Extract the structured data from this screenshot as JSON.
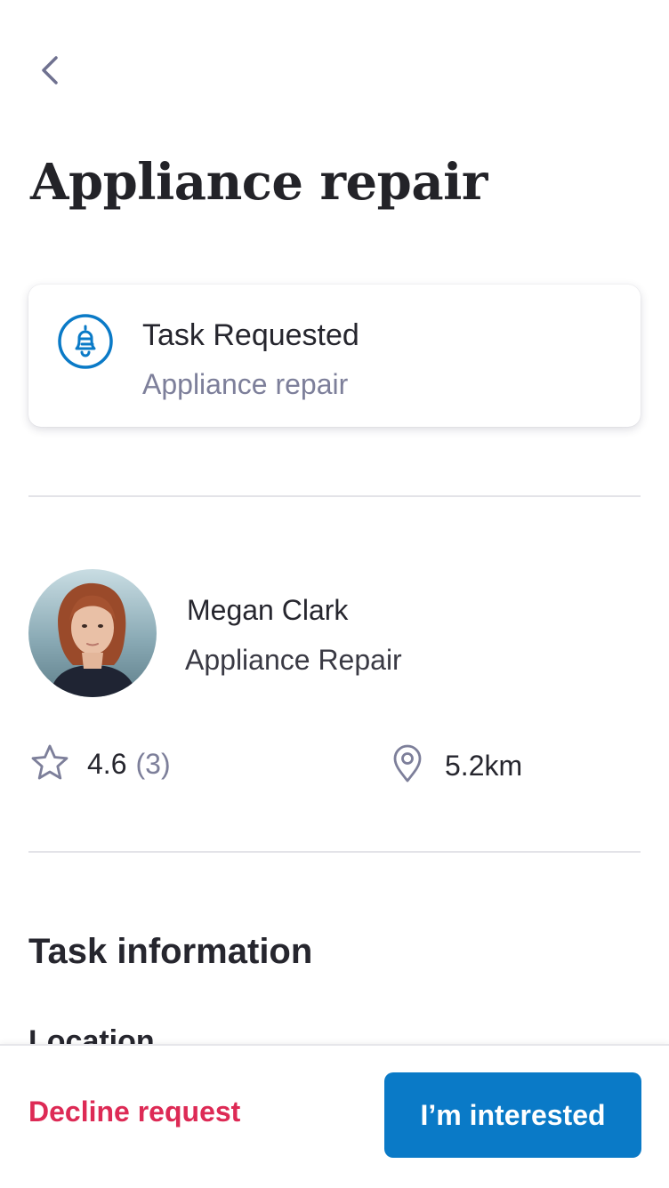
{
  "header": {
    "back_icon": "chevron-left-icon",
    "title": "Appliance repair"
  },
  "status_card": {
    "icon": "bell-icon",
    "title": "Task Requested",
    "subtitle": "Appliance repair",
    "accent_color": "#0a7ac7"
  },
  "provider": {
    "name": "Megan Clark",
    "service": "Appliance Repair",
    "rating": "4.6",
    "review_count": "(3)",
    "distance": "5.2km"
  },
  "task_info": {
    "section_title": "Task information",
    "location_label": "Location"
  },
  "actions": {
    "decline_label": "Decline request",
    "interested_label": "I’m interested",
    "decline_color": "#dd2a55",
    "primary_color": "#0a7ac7"
  }
}
